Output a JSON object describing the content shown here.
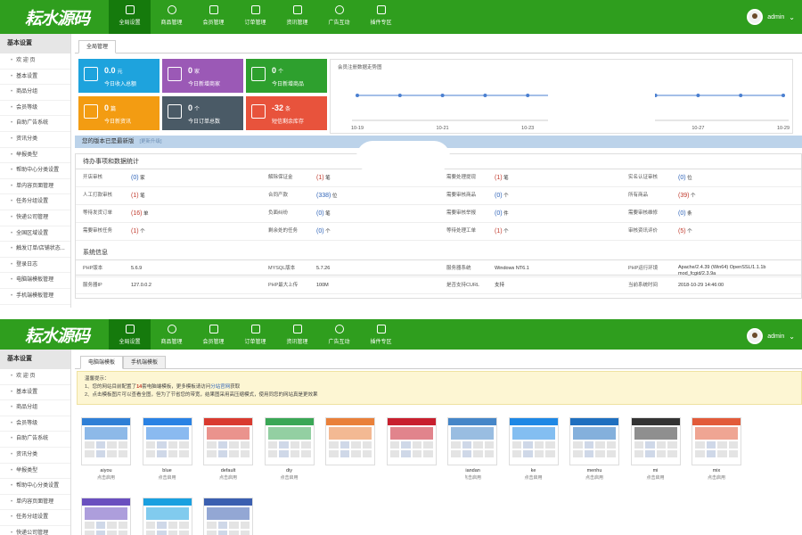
{
  "app": {
    "logo_text": "耘水源码",
    "user_name": "admin",
    "nav": [
      {
        "label": "全局设置",
        "icon": "grid-icon",
        "active": true
      },
      {
        "label": "商品管理",
        "icon": "user-icon",
        "active": false
      },
      {
        "label": "会员管理",
        "icon": "book-icon",
        "active": false
      },
      {
        "label": "订单管理",
        "icon": "camera-icon",
        "active": false
      },
      {
        "label": "资讯管理",
        "icon": "calendar-icon",
        "active": false
      },
      {
        "label": "广告互动",
        "icon": "gear-icon",
        "active": false
      },
      {
        "label": "插件专区",
        "icon": "plugin-icon",
        "active": false
      }
    ]
  },
  "sidebar": {
    "title": "基本设置",
    "items_a": [
      "欢 迎 页",
      "基本设置",
      "商品分组",
      "会员等级",
      "自助广告系统",
      "资讯分类",
      "举报类型",
      "帮助中心分类设置",
      "单内容页面管理",
      "任务分组设置",
      "快递公司管理",
      "全国区域设置",
      "触发订单/店铺状态...",
      "登录日志",
      "电脑端模板管理",
      "手机端模板管理"
    ],
    "items_b": [
      "欢 迎 页",
      "基本设置",
      "商品分组",
      "会员等级",
      "自助广告系统",
      "资讯分类",
      "举报类型",
      "帮助中心分类设置",
      "单内容页面管理",
      "任务分组设置",
      "快递公司管理"
    ]
  },
  "dashboard": {
    "tab": "全局管理",
    "tiles": [
      {
        "value": "0.0",
        "unit": "元",
        "label": "今日收入总额",
        "color": "#1ea3dd",
        "icon": "wallet-icon"
      },
      {
        "value": "0",
        "unit": "家",
        "label": "今日新增商家",
        "color": "#9b59b6",
        "icon": "list-icon"
      },
      {
        "value": "0",
        "unit": "个",
        "label": "今日新增商品",
        "color": "#2ea02e",
        "icon": "clock-doc-icon"
      },
      {
        "value": "0",
        "unit": "篇",
        "label": "今日新资讯",
        "color": "#f39c12",
        "icon": "mail-icon"
      },
      {
        "value": "0",
        "unit": "个",
        "label": "今日订单总数",
        "color": "#4a5a66",
        "icon": "hand-icon"
      },
      {
        "value": "-32",
        "unit": "条",
        "label": "短信剩余库存",
        "color": "#e8533c",
        "icon": "plus-icon"
      }
    ],
    "notice_title": "您的版本已是最新版",
    "notice_hint": "[更新升级]",
    "todo_title": "待办事项和数据统计",
    "todo_rows": [
      [
        [
          "开店审核",
          "(0)",
          "家",
          "blue"
        ],
        [
          "解除保证金",
          "(1)",
          "笔",
          "red"
        ],
        [
          "需要处理提现",
          "(1)",
          "笔",
          "red"
        ],
        [
          "实名认证审核",
          "(0)",
          "位",
          "blue"
        ]
      ],
      [
        [
          "人工打款审核",
          "(1)",
          "笔",
          "red"
        ],
        [
          "合同产款",
          "(338)",
          "位",
          "blue"
        ],
        [
          "需要审核商品",
          "(0)",
          "个",
          "blue"
        ],
        [
          "所有商品",
          "(39)",
          "个",
          "red"
        ]
      ],
      [
        [
          "等待发货订单",
          "(16)",
          "单",
          "red"
        ],
        [
          "负面纠纷",
          "(0)",
          "笔",
          "blue"
        ],
        [
          "需要审核举报",
          "(0)",
          "件",
          "blue"
        ],
        [
          "需要审核维修",
          "(0)",
          "条",
          "blue"
        ]
      ],
      [
        [
          "需要审核任务",
          "(1)",
          "个",
          "red"
        ],
        [
          "剩余处的任务",
          "(0)",
          "个",
          "blue"
        ],
        [
          "等待处理工单",
          "(1)",
          "个",
          "red"
        ],
        [
          "审核资讯评价",
          "(5)",
          "个",
          "red"
        ]
      ]
    ],
    "sys_title": "系统信息",
    "sys_rows": [
      [
        [
          "PHP版本",
          "5.6.9"
        ],
        [
          "MYSQL版本",
          "5.7.26"
        ],
        [
          "服务器系统",
          "Windows NT6.1"
        ],
        [
          "PHP运行环境",
          "Apache/2.4.39 (Win64) OpenSSL/1.1.1b mod_fcgid/2.3.9a"
        ]
      ],
      [
        [
          "服务器IP",
          "127.0.0.2"
        ],
        [
          "PHP最大上传",
          "100M"
        ],
        [
          "是否支持CURL",
          "支持"
        ],
        [
          "当前系统时间",
          "2018-10-29 14:46:00"
        ]
      ]
    ]
  },
  "chart_data": {
    "type": "line",
    "title": "会员注册数据走势图",
    "x": [
      "10-19",
      "",
      "10-21",
      "",
      "10-23",
      "",
      "",
      "",
      "10-27",
      "",
      "10-29"
    ],
    "series": [
      {
        "values": [
          0,
          0,
          0,
          0,
          0,
          0,
          0,
          0,
          0,
          0,
          0
        ]
      }
    ]
  },
  "templates_page": {
    "tabs": [
      "电脑端模板",
      "手机端模板"
    ],
    "active_tab": 0,
    "notice_title": "温馨提示：",
    "notice_line1_pre": "1、您的网站目前配置了",
    "notice_line1_num": "14",
    "notice_line1_mid": "套电脑端模板，更多模板请访问",
    "notice_line1_link": "分站官网",
    "notice_line1_post": "获取",
    "notice_line2": "2、点击模板图片可以查看全图，但为了节省您的带宽，结果图采用高压缩模式，使用同您的网站真是更效果",
    "templates": [
      {
        "name": "aiyou",
        "action": "点击启用",
        "color": "#2f7fd6"
      },
      {
        "name": "blue",
        "action": "点击启用",
        "color": "#2a82e4"
      },
      {
        "name": "default",
        "action": "点击启用",
        "color": "#d93a2f"
      },
      {
        "name": "diy",
        "action": "点击启用",
        "color": "#3aa756"
      },
      {
        "name": "",
        "action": "",
        "color": "#e9803a"
      },
      {
        "name": "",
        "action": "",
        "color": "#c81f2e"
      },
      {
        "name": "jiandan",
        "action": "点击启用",
        "color": "#4586c8"
      },
      {
        "name": "ke",
        "action": "点击启用",
        "color": "#1e88e5"
      },
      {
        "name": "menhu",
        "action": "点击启用",
        "color": "#1f6fbf"
      },
      {
        "name": "mi",
        "action": "点击启用",
        "color": "#333333"
      },
      {
        "name": "mix",
        "action": "点击启用",
        "color": "#e25b3a"
      },
      {
        "name": "",
        "action": "",
        "color": "#6a4fbf"
      },
      {
        "name": "",
        "action": "",
        "color": "#1aa0e0"
      },
      {
        "name": "",
        "action": "",
        "color": "#3b5fb0"
      }
    ]
  }
}
